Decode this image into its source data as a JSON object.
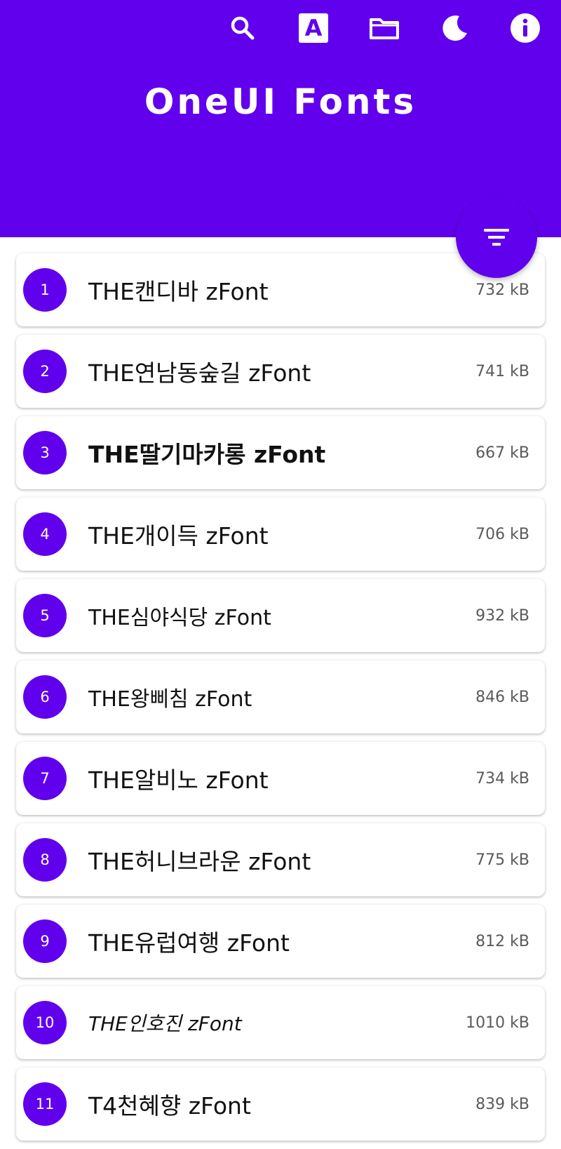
{
  "colors": {
    "accent": "#6100ED",
    "on_accent": "#ffffff",
    "card_background": "#ffffff",
    "text_primary": "#111111",
    "text_secondary": "#5a5a5a"
  },
  "toolbar": {
    "icons": [
      "search-icon",
      "font-icon",
      "folder-icon",
      "dark-mode-icon",
      "info-icon"
    ],
    "font_icon_letter": "A"
  },
  "header": {
    "title": "OneUI Fonts"
  },
  "fab": {
    "icon": "filter-icon"
  },
  "fonts": [
    {
      "index": "1",
      "name": "THE캔디바 zFont",
      "size": "732 kB"
    },
    {
      "index": "2",
      "name": "THE연남동숲길 zFont",
      "size": "741 kB"
    },
    {
      "index": "3",
      "name": "THE딸기마카롱 zFont",
      "size": "667 kB"
    },
    {
      "index": "4",
      "name": "THE개이득 zFont",
      "size": "706 kB"
    },
    {
      "index": "5",
      "name": "THE심야식당 zFont",
      "size": "932 kB"
    },
    {
      "index": "6",
      "name": "THE왕삐침 zFont",
      "size": "846 kB"
    },
    {
      "index": "7",
      "name": "THE알비노 zFont",
      "size": "734 kB"
    },
    {
      "index": "8",
      "name": "THE허니브라운 zFont",
      "size": "775 kB"
    },
    {
      "index": "9",
      "name": "THE유럽여행 zFont",
      "size": "812 kB"
    },
    {
      "index": "10",
      "name": "THE인호진 zFont",
      "size": "1010 kB"
    },
    {
      "index": "11",
      "name": "T4천혜향 zFont",
      "size": "839 kB"
    }
  ]
}
